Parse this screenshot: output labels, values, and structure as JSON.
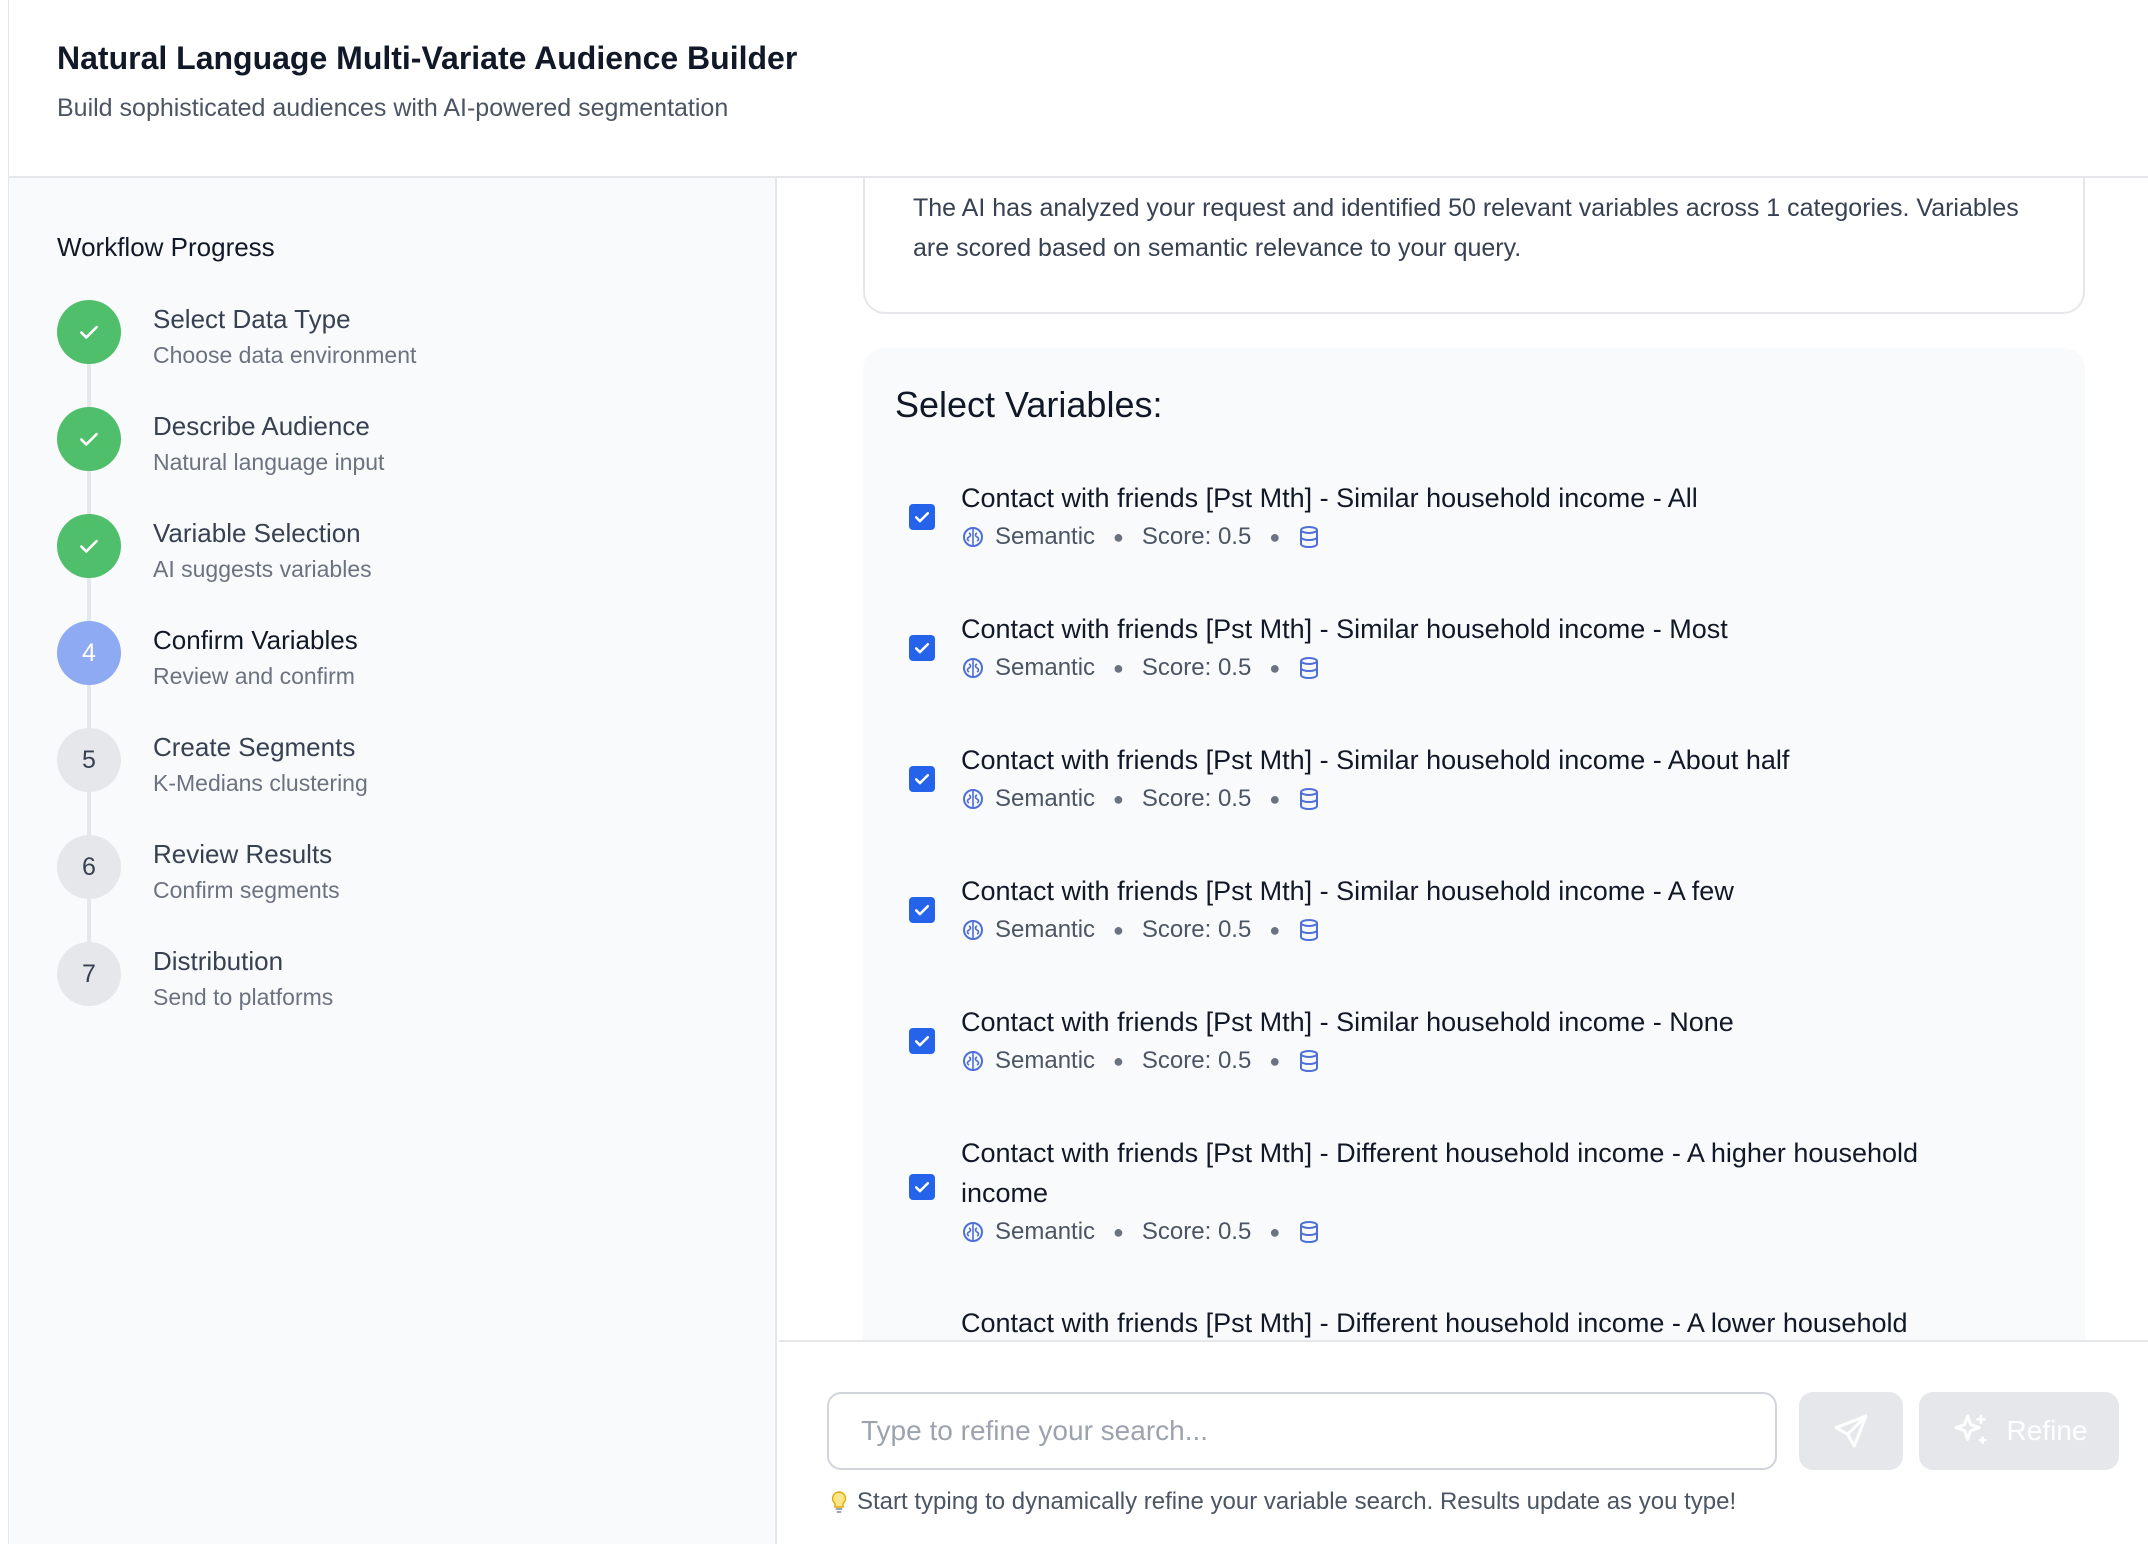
{
  "header": {
    "title": "Natural Language Multi-Variate Audience Builder",
    "subtitle": "Build sophisticated audiences with AI-powered segmentation"
  },
  "sidebar": {
    "title": "Workflow Progress",
    "steps": [
      {
        "number": "1",
        "name": "Select Data Type",
        "description": "Choose data environment",
        "status": "completed"
      },
      {
        "number": "2",
        "name": "Describe Audience",
        "description": "Natural language input",
        "status": "completed"
      },
      {
        "number": "3",
        "name": "Variable Selection",
        "description": "AI suggests variables",
        "status": "completed"
      },
      {
        "number": "4",
        "name": "Confirm Variables",
        "description": "Review and confirm",
        "status": "current"
      },
      {
        "number": "5",
        "name": "Create Segments",
        "description": "K-Medians clustering",
        "status": "pending"
      },
      {
        "number": "6",
        "name": "Review Results",
        "description": "Confirm segments",
        "status": "pending"
      },
      {
        "number": "7",
        "name": "Distribution",
        "description": "Send to platforms",
        "status": "pending"
      }
    ]
  },
  "main": {
    "info_text": "The AI has analyzed your request and identified 50 relevant variables across 1 categories. Variables are scored based on semantic relevance to your query.",
    "variables_heading": "Select Variables:",
    "variables": [
      {
        "label": "Contact with friends [Pst Mth] - Similar household income - All",
        "type": "Semantic",
        "score": "Score: 0.5",
        "checked": true
      },
      {
        "label": "Contact with friends [Pst Mth] - Similar household income - Most",
        "type": "Semantic",
        "score": "Score: 0.5",
        "checked": true
      },
      {
        "label": "Contact with friends [Pst Mth] - Similar household income - About half",
        "type": "Semantic",
        "score": "Score: 0.5",
        "checked": true
      },
      {
        "label": "Contact with friends [Pst Mth] - Similar household income - A few",
        "type": "Semantic",
        "score": "Score: 0.5",
        "checked": true
      },
      {
        "label": "Contact with friends [Pst Mth] - Similar household income - None",
        "type": "Semantic",
        "score": "Score: 0.5",
        "checked": true
      },
      {
        "label": "Contact with friends [Pst Mth] - Different household income - A higher household income",
        "type": "Semantic",
        "score": "Score: 0.5",
        "checked": true
      },
      {
        "label": "Contact with friends [Pst Mth] - Different household income - A lower household",
        "type": "",
        "score": "",
        "checked": true
      }
    ]
  },
  "bottom": {
    "search_placeholder": "Type to refine your search...",
    "refine_label": "Refine",
    "hint": "Start typing to dynamically refine your variable search. Results update as you type!"
  },
  "colors": {
    "completed": "#4fbf6b",
    "current": "#8eaaf2",
    "checkbox": "#2563eb",
    "icon_blue": "#4f6fd8"
  },
  "icons": {
    "completed_step": "check-icon",
    "semantic": "brain-icon",
    "data_source": "database-icon",
    "send": "send-icon",
    "refine": "sparkles-icon",
    "hint": "lightbulb-icon"
  }
}
